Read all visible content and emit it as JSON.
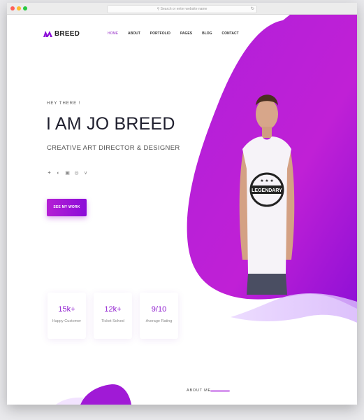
{
  "browser": {
    "url_placeholder": "Search or enter website name",
    "dot_colors": [
      "#ff5f57",
      "#febc2e",
      "#28c840"
    ]
  },
  "brand": {
    "logo_text": "BREED",
    "accent": "#9a12d8",
    "accent_dark": "#8b0cd8"
  },
  "nav": {
    "items": [
      {
        "label": "HOME",
        "active": true
      },
      {
        "label": "ABOUT",
        "active": false
      },
      {
        "label": "PORTFOLIO",
        "active": false
      },
      {
        "label": "PAGES",
        "active": false
      },
      {
        "label": "BLOG",
        "active": false
      },
      {
        "label": "CONTACT",
        "active": false
      }
    ]
  },
  "hero": {
    "greeting": "HEY THERE !",
    "title": "I AM JO BREED",
    "subtitle": "CREATIVE ART DIRECTOR & DESIGNER",
    "cta_label": "SEE MY WORK",
    "socials": [
      "twitter-icon",
      "skype-icon",
      "instagram-icon",
      "dribbble-icon",
      "vine-icon"
    ],
    "shirt_text": "LEGENDARY"
  },
  "stats": [
    {
      "value": "15k+",
      "label": "Happy Customer"
    },
    {
      "value": "12k+",
      "label": "Ticket Solved"
    },
    {
      "value": "9/10",
      "label": "Average Rating"
    }
  ],
  "about": {
    "label": "ABOUT ME"
  }
}
